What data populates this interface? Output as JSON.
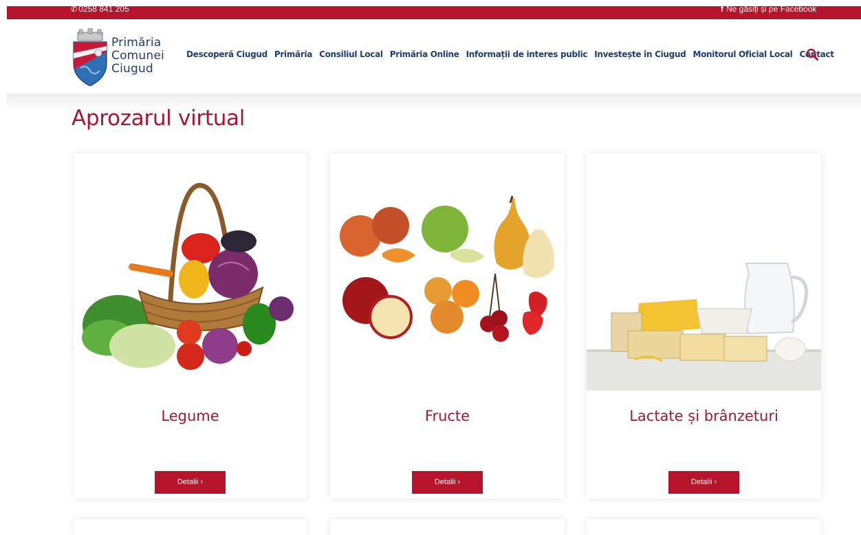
{
  "topbar": {
    "phone": "0258 841 205",
    "facebook": "Ne găsiți și pe Facebook"
  },
  "brand": {
    "line1": "Primăria",
    "line2": "Comunei",
    "line3": "Ciugud"
  },
  "nav": [
    "Descoperă Ciugud",
    "Primăria",
    "Consiliul Local",
    "Primăria Online",
    "Informații de interes public",
    "Investește în Ciugud",
    "Monitorul Oficial Local",
    "Contact"
  ],
  "page": {
    "title": "Aprozarul virtual"
  },
  "cards": [
    {
      "label": "Legume",
      "button": "Detalii ›"
    },
    {
      "label": "Fructe",
      "button": "Detalii ›"
    },
    {
      "label": "Lactate și brânzeturi",
      "button": "Detalii ›"
    }
  ],
  "colors": {
    "brand_red": "#b5142a",
    "title_red": "#a8172d",
    "nav_blue": "#1f3d6e"
  },
  "icons": {
    "phone": "phone-icon",
    "facebook": "facebook-icon",
    "search": "search-icon",
    "crest": "crest-icon"
  }
}
